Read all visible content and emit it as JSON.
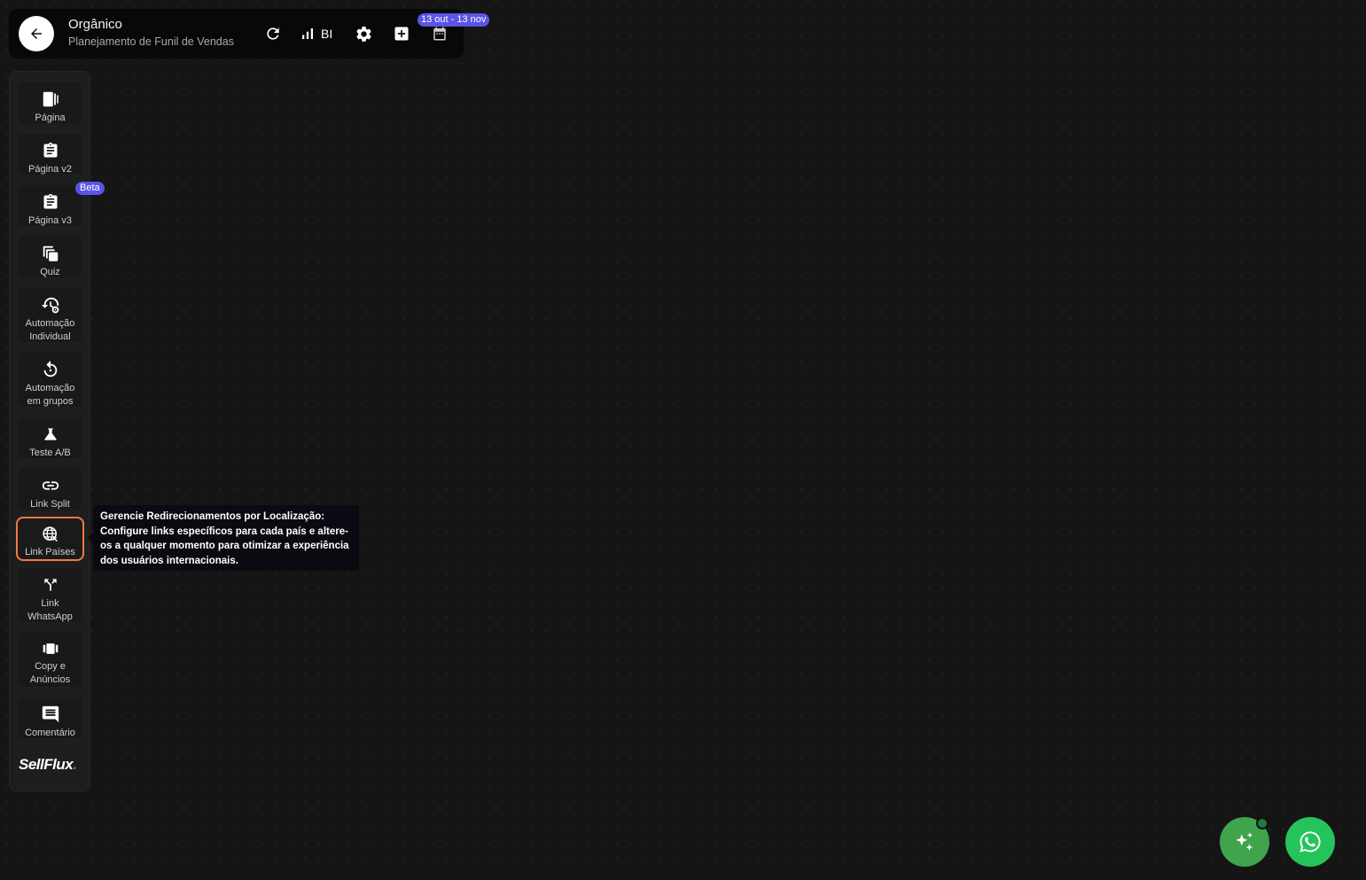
{
  "header": {
    "title": "Orgânico",
    "subtitle": "Planejamento de Funil de Vendas",
    "bi_label": "BI",
    "date_range": "13 out - 13 nov",
    "icons": [
      "back-arrow-icon",
      "refresh-icon",
      "bar-chart-icon",
      "gear-icon",
      "add-box-icon",
      "calendar-icon"
    ]
  },
  "sidebar": {
    "items": [
      {
        "label": "Página",
        "icon": "page-icon"
      },
      {
        "label": "Página v2",
        "icon": "clipboard-icon"
      },
      {
        "label": "Página v3",
        "icon": "clipboard-icon",
        "badge": "Beta"
      },
      {
        "label": "Quiz",
        "icon": "copy-icon"
      },
      {
        "label": "Automação\nIndividual",
        "icon": "history-gear-icon"
      },
      {
        "label": "Automação\nem grupos",
        "icon": "rotate-icon"
      },
      {
        "label": "Teste A/B",
        "icon": "flask-icon"
      },
      {
        "label": "Link Split",
        "icon": "link-icon"
      },
      {
        "label": "Link Países",
        "icon": "globe-icon",
        "active": true
      },
      {
        "label": "Link\nWhatsApp",
        "icon": "fork-arrow-icon"
      },
      {
        "label": "Copy e\nAnúncios",
        "icon": "carousel-icon"
      },
      {
        "label": "Comentário",
        "icon": "comment-icon"
      }
    ],
    "brand": "SellFlux",
    "brand_dot": "."
  },
  "tooltip": {
    "text": "Gerencie Redirecionamentos por Localização: Configure links específicos para cada país e altere-os a qualquer momento para otimizar a experiência dos usuários internacionais."
  },
  "floating": {
    "ai_button": "sparkles-icon",
    "whatsapp_button": "whatsapp-icon"
  },
  "colors": {
    "background": "#151515",
    "accent_purple": "#5b54e6",
    "active_border": "#f07a3e",
    "ai_green": "#3fa44b",
    "whatsapp_green": "#25c45a"
  }
}
